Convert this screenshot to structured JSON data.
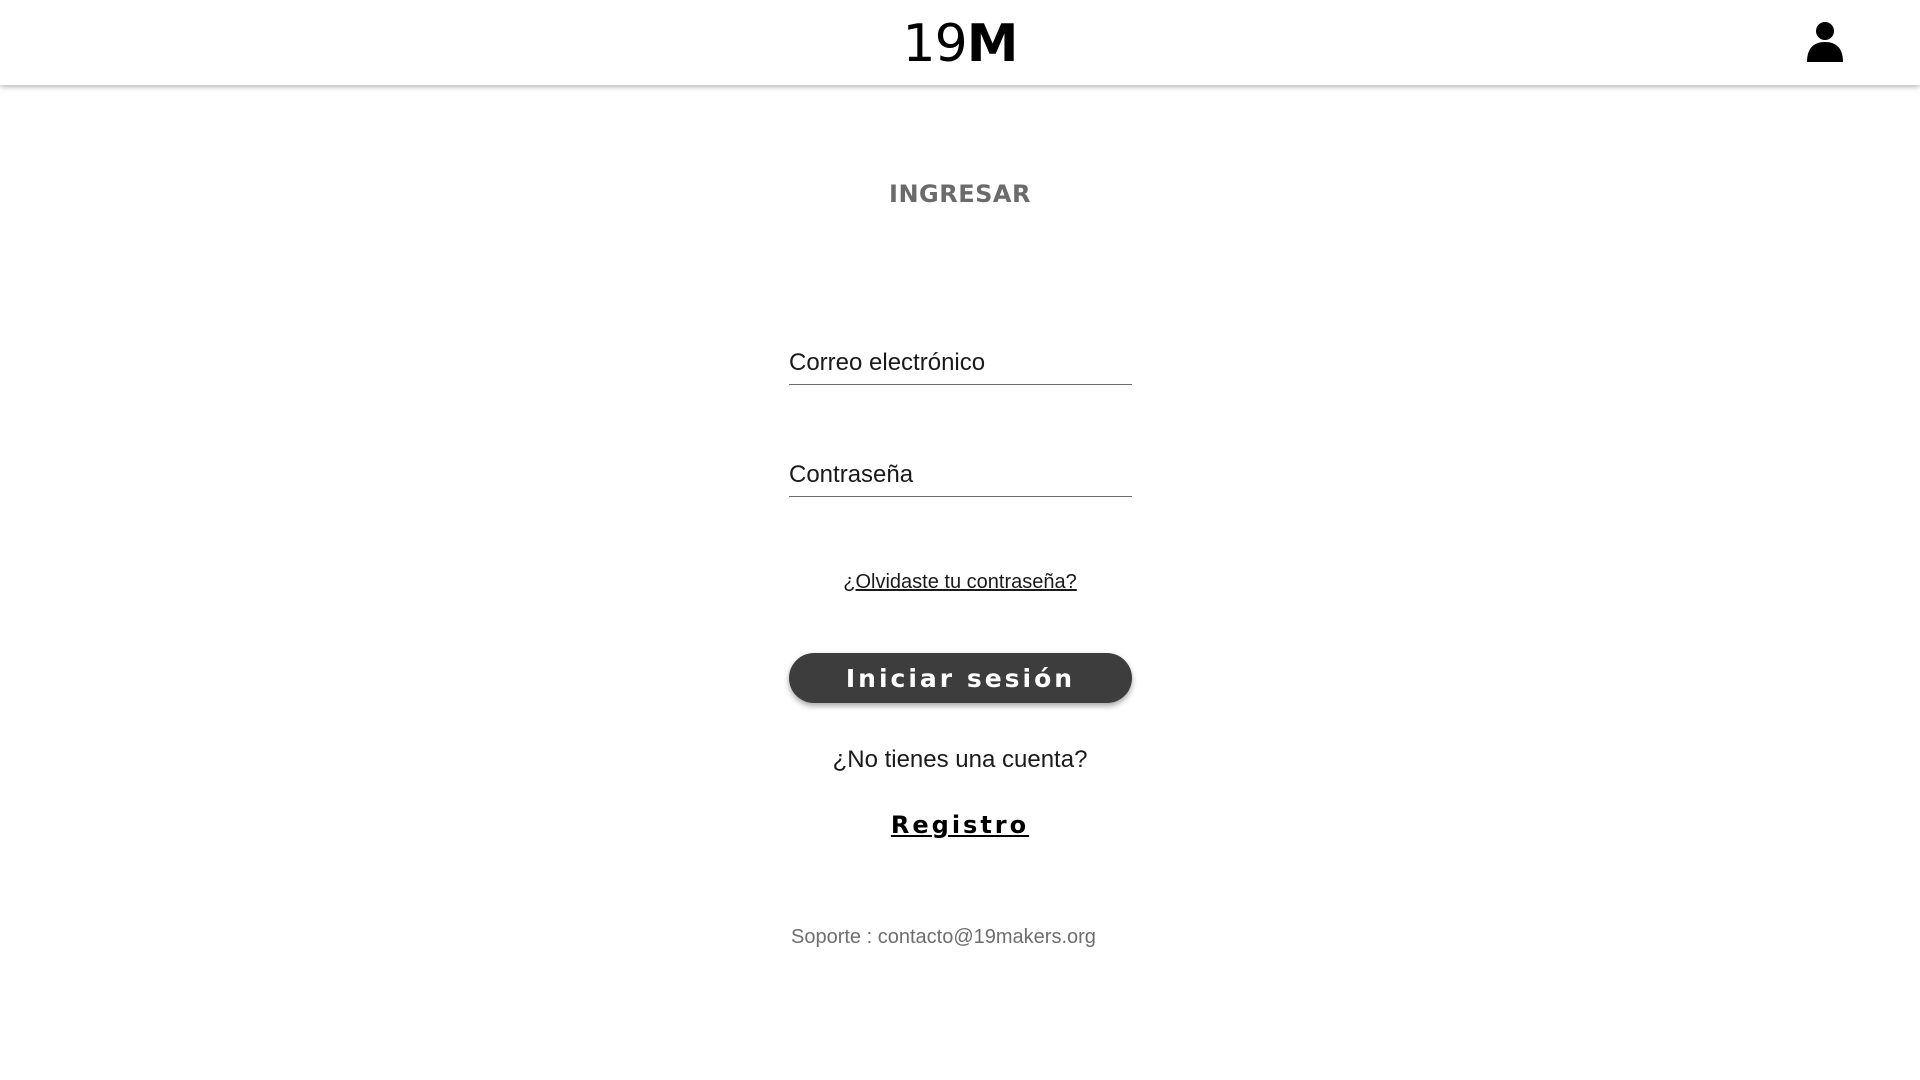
{
  "header": {
    "logo_number": "19",
    "logo_letter": "M",
    "user_icon": "user-icon"
  },
  "login": {
    "title": "INGRESAR",
    "email_placeholder": "Correo electrónico",
    "password_placeholder": "Contraseña",
    "forgot_password": "¿Olvidaste tu contraseña?",
    "submit_label": "Iniciar sesión",
    "no_account": "¿No tienes una cuenta?",
    "register_label": "Registro"
  },
  "footer": {
    "support": "Soporte : contacto@19makers.org"
  },
  "colors": {
    "button_bg": "#3d3d3d",
    "title_color": "#6b6b6b",
    "support_color": "#6e6e6e"
  }
}
